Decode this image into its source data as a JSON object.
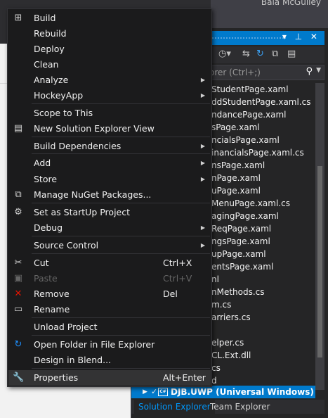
{
  "background": {
    "user_name": "Bala McGulley",
    "search_placeholder": "orer (Ctrl+;)"
  },
  "solution_explorer": {
    "files": [
      "StudentPage.xaml",
      "ddStudentPage.xaml.cs",
      "ndancePage.xaml",
      "sPage.xaml",
      "ncialsPage.xaml",
      "inancialsPage.xaml.cs",
      "nsPage.xaml",
      "nPage.xaml",
      "uPage.xaml",
      "MenuPage.xaml.cs",
      "agingPage.xaml",
      "ReqPage.xaml",
      "ngsPage.xaml",
      "upPage.xaml",
      "entsPage.xaml",
      "nl",
      "nMethods.cs",
      "m.cs",
      "arriers.cs",
      "",
      "elper.cs",
      "CL.Ext.dll",
      "cs",
      "d"
    ],
    "selected_project": "DJB.UWP (Universal Windows)",
    "tabs": [
      "Solution Explorer",
      "Team Explorer"
    ]
  },
  "context_menu": {
    "items": [
      {
        "id": "build",
        "label": "Build",
        "icon": "build-icon",
        "icon_glyph": "⊞",
        "shortcut": "",
        "submenu": false,
        "disabled": false
      },
      {
        "id": "rebuild",
        "label": "Rebuild",
        "icon": "",
        "icon_glyph": "",
        "shortcut": "",
        "submenu": false,
        "disabled": false
      },
      {
        "id": "deploy",
        "label": "Deploy",
        "icon": "",
        "icon_glyph": "",
        "shortcut": "",
        "submenu": false,
        "disabled": false
      },
      {
        "id": "clean",
        "label": "Clean",
        "icon": "",
        "icon_glyph": "",
        "shortcut": "",
        "submenu": false,
        "disabled": false
      },
      {
        "id": "analyze",
        "label": "Analyze",
        "icon": "",
        "icon_glyph": "",
        "shortcut": "",
        "submenu": true,
        "disabled": false
      },
      {
        "id": "hockeyapp",
        "label": "HockeyApp",
        "icon": "",
        "icon_glyph": "",
        "shortcut": "",
        "submenu": true,
        "disabled": false
      },
      {
        "id": "scope",
        "label": "Scope to This",
        "icon": "",
        "icon_glyph": "",
        "shortcut": "",
        "submenu": false,
        "disabled": false
      },
      {
        "id": "new-se-view",
        "label": "New Solution Explorer View",
        "icon": "new-view-icon",
        "icon_glyph": "▤",
        "shortcut": "",
        "submenu": false,
        "disabled": false
      },
      {
        "id": "build-deps",
        "label": "Build Dependencies",
        "icon": "",
        "icon_glyph": "",
        "shortcut": "",
        "submenu": true,
        "disabled": false
      },
      {
        "id": "add",
        "label": "Add",
        "icon": "",
        "icon_glyph": "",
        "shortcut": "",
        "submenu": true,
        "disabled": false
      },
      {
        "id": "store",
        "label": "Store",
        "icon": "",
        "icon_glyph": "",
        "shortcut": "",
        "submenu": true,
        "disabled": false
      },
      {
        "id": "nuget",
        "label": "Manage NuGet Packages...",
        "icon": "nuget-icon",
        "icon_glyph": "⧉",
        "shortcut": "",
        "submenu": false,
        "disabled": false
      },
      {
        "id": "startup",
        "label": "Set as StartUp Project",
        "icon": "gear-icon",
        "icon_glyph": "⚙",
        "shortcut": "",
        "submenu": false,
        "disabled": false
      },
      {
        "id": "debug",
        "label": "Debug",
        "icon": "",
        "icon_glyph": "",
        "shortcut": "",
        "submenu": true,
        "disabled": false
      },
      {
        "id": "source-control",
        "label": "Source Control",
        "icon": "",
        "icon_glyph": "",
        "shortcut": "",
        "submenu": true,
        "disabled": false
      },
      {
        "id": "cut",
        "label": "Cut",
        "icon": "scissors-icon",
        "icon_glyph": "✂",
        "shortcut": "Ctrl+X",
        "submenu": false,
        "disabled": false
      },
      {
        "id": "paste",
        "label": "Paste",
        "icon": "paste-icon",
        "icon_glyph": "▣",
        "shortcut": "Ctrl+V",
        "submenu": false,
        "disabled": true
      },
      {
        "id": "remove",
        "label": "Remove",
        "icon": "remove-x-icon",
        "icon_glyph": "✕",
        "shortcut": "Del",
        "submenu": false,
        "disabled": false
      },
      {
        "id": "rename",
        "label": "Rename",
        "icon": "rename-icon",
        "icon_glyph": "▭",
        "shortcut": "",
        "submenu": false,
        "disabled": false
      },
      {
        "id": "unload",
        "label": "Unload Project",
        "icon": "",
        "icon_glyph": "",
        "shortcut": "",
        "submenu": false,
        "disabled": false
      },
      {
        "id": "open-folder",
        "label": "Open Folder in File Explorer",
        "icon": "open-folder-icon",
        "icon_glyph": "↻",
        "shortcut": "",
        "submenu": false,
        "disabled": false
      },
      {
        "id": "blend",
        "label": "Design in Blend...",
        "icon": "",
        "icon_glyph": "",
        "shortcut": "",
        "submenu": false,
        "disabled": false
      },
      {
        "id": "properties",
        "label": "Properties",
        "icon": "wrench-icon",
        "icon_glyph": "🔧",
        "shortcut": "Alt+Enter",
        "submenu": false,
        "disabled": false,
        "highlighted": true
      }
    ],
    "icon_colors": {
      "remove": "#e51400",
      "open-folder": "#1e90ff"
    }
  }
}
